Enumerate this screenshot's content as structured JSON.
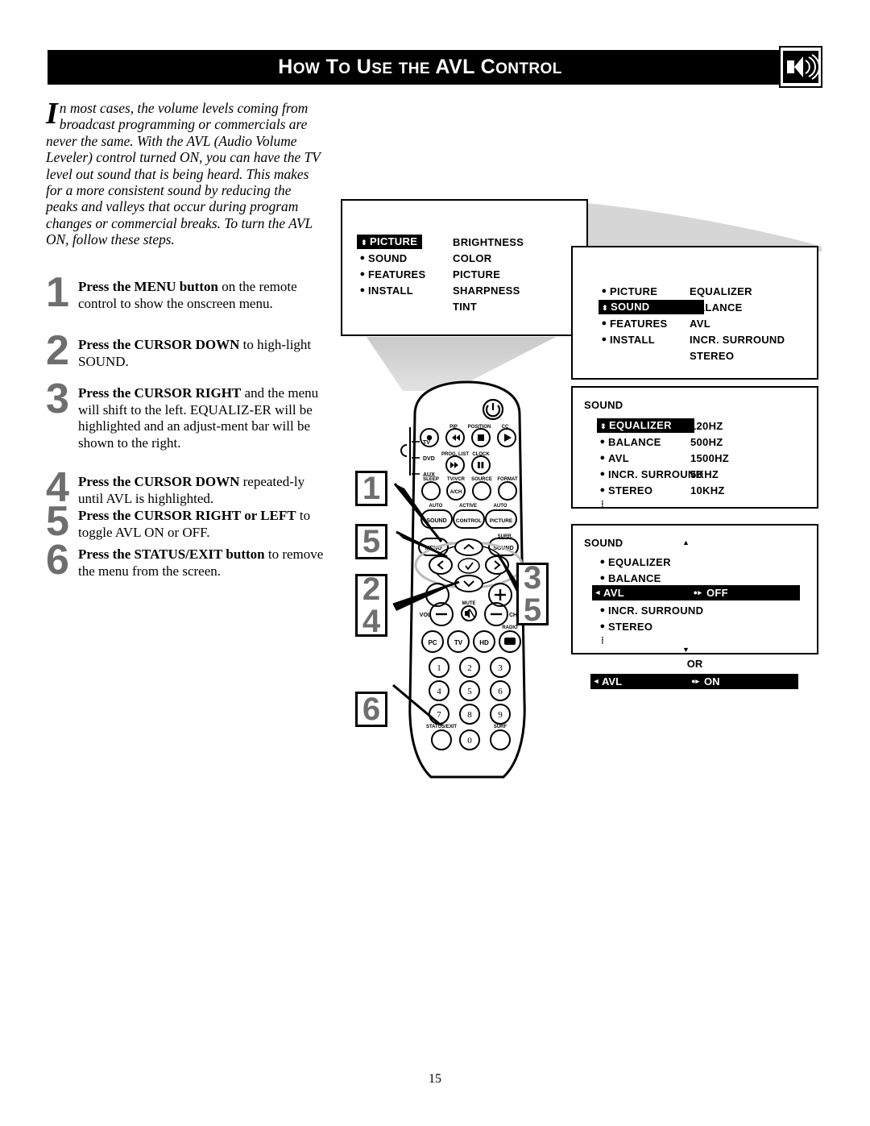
{
  "header": {
    "title_parts": [
      {
        "t": "H",
        "big": true
      },
      {
        "t": "OW",
        "big": false
      },
      {
        "t": " T",
        "big": true
      },
      {
        "t": "O",
        "big": false
      },
      {
        "t": " U",
        "big": true
      },
      {
        "t": "SE",
        "big": false
      },
      {
        "t": " ",
        "big": false
      },
      {
        "t": "THE",
        "big": false
      },
      {
        "t": " AVL ",
        "big": true
      },
      {
        "t": "C",
        "big": true
      },
      {
        "t": "ONTROL",
        "big": false
      }
    ],
    "title": "HOW TO USE THE AVL CONTROL",
    "icon": "speaker-volume-icon"
  },
  "intro": {
    "dropcap": "I",
    "text": "n most cases, the volume levels coming from broadcast programming or commercials are never the same.  With the AVL (Audio Volume Leveler) control turned ON, you can have the TV level out sound that is being heard.  This makes for a more consistent sound by reducing the peaks and valleys that occur during program changes or commercial breaks.  To turn the AVL ON, follow these steps."
  },
  "steps": [
    {
      "num": "1",
      "bold": "Press the MENU button",
      "rest": " on the remote control to show the onscreen menu."
    },
    {
      "num": "2",
      "bold": "Press the CURSOR DOWN",
      "rest": " to high-light SOUND."
    },
    {
      "num": "3",
      "bold": "Press the CURSOR RIGHT",
      "rest": " and the menu will shift to the left. EQUALIZ-ER will be highlighted and an adjust-ment bar will be shown to the right."
    },
    {
      "num": "4",
      "bold": "Press the CURSOR DOWN",
      "rest": " repeated-ly until AVL is highlighted."
    },
    {
      "num": "5",
      "bold": "Press the CURSOR RIGHT or LEFT",
      "rest": " to toggle AVL ON or OFF."
    },
    {
      "num": "6",
      "bold": "Press the STATUS/EXIT button",
      "rest": " to remove the menu from the screen."
    }
  ],
  "osd_menus": {
    "menu1": {
      "left_items": [
        "PICTURE",
        "SOUND",
        "FEATURES",
        "INSTALL"
      ],
      "highlighted": "PICTURE",
      "right_items": [
        "BRIGHTNESS",
        "COLOR",
        "PICTURE",
        "SHARPNESS",
        "TINT"
      ]
    },
    "menu2": {
      "left_items": [
        "PICTURE",
        "SOUND",
        "FEATURES",
        "INSTALL"
      ],
      "highlighted": "SOUND",
      "right_items": [
        "EQUALIZER",
        "BALANCE",
        "AVL",
        "INCR.  SURROUND",
        "STEREO"
      ]
    },
    "menu3": {
      "title": "SOUND",
      "left_items": [
        "EQUALIZER",
        "BALANCE",
        "AVL",
        "INCR.  SURROUND",
        "STEREO"
      ],
      "highlighted": "EQUALIZER",
      "right_items": [
        "120HZ",
        "500HZ",
        "1500HZ",
        "5KHZ",
        "10KHZ"
      ]
    },
    "menu4": {
      "title": "SOUND",
      "items": [
        "EQUALIZER",
        "BALANCE",
        "AVL",
        "INCR.  SURROUND",
        "STEREO"
      ],
      "highlighted": "AVL",
      "highlight_value": "OFF",
      "or_label": "OR",
      "alt_row_label": "AVL",
      "alt_row_value": "ON",
      "up_arrow": "▲",
      "down_arrow": "▼"
    }
  },
  "remote": {
    "name": "tv-remote-control",
    "side_labels": [
      "TV",
      "DVD",
      "AUX"
    ],
    "power_icon": "power-icon",
    "row1": {
      "top_labels": [
        "",
        "PIP",
        "POSITION",
        "CC"
      ],
      "buttons": [
        "●",
        "◀◀",
        "■",
        "▶"
      ]
    },
    "row2": {
      "top_labels": [
        "PROG. LIST",
        "CLOCK"
      ],
      "buttons": [
        "▶▶",
        "❚❚"
      ]
    },
    "row3": {
      "labels": [
        "SLEEP",
        "TV/VCR",
        "SOURCE",
        "FORMAT"
      ],
      "inner": [
        "",
        "A/CH",
        "",
        ""
      ]
    },
    "row4": {
      "top_labels": [
        "AUTO",
        "ACTIVE",
        "AUTO"
      ],
      "buttons": [
        "SOUND",
        "CONTROL",
        "PICTURE"
      ]
    },
    "row5": {
      "menu": "MENU",
      "surr_label": "SURR.",
      "sound": "SOUND"
    },
    "cursor": {
      "up": "︿",
      "down": "﹀",
      "left": "‹",
      "right": "›",
      "ok": "✓"
    },
    "vol_ch": {
      "vol": "VOL",
      "ch": "CH",
      "mute_label": "MUTE",
      "mute_icon": "mute-icon",
      "plus": "+",
      "minus": "−"
    },
    "source_row": [
      "PC",
      "TV",
      "HD",
      "RADIO"
    ],
    "radio_label": "RADIO",
    "keypad": [
      "1",
      "2",
      "3",
      "4",
      "5",
      "6",
      "7",
      "8",
      "9",
      "0"
    ],
    "status_label": "STATUS/EXIT",
    "surf_label": "SURF"
  },
  "callouts": [
    {
      "id": "c1",
      "values": [
        "1"
      ]
    },
    {
      "id": "c5",
      "values": [
        "5"
      ]
    },
    {
      "id": "c24",
      "values": [
        "2",
        "4"
      ]
    },
    {
      "id": "c6",
      "values": [
        "6"
      ]
    },
    {
      "id": "c35",
      "values": [
        "3",
        "5"
      ]
    }
  ],
  "page_number": "15",
  "colors": {
    "header_bg": "#000000",
    "header_text": "#ffffff",
    "step_number": "#6e6e6e",
    "beam_gray": "#d4d4d4",
    "osd_border": "#000000"
  }
}
